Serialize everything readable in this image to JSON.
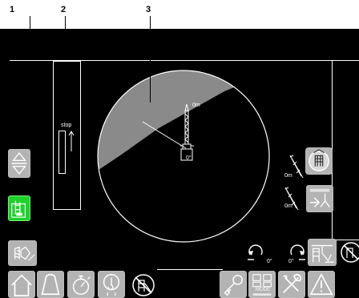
{
  "callouts": [
    "1",
    "2",
    "3"
  ],
  "boom_indicator": {
    "stop_label": "stop"
  },
  "dial": {
    "height_label": "0m",
    "angle_label": "0°",
    "colors": {
      "shade": "#8a8a8a",
      "ring": "#ffffff"
    }
  },
  "right_panel": {
    "upper_ramp_label": "0m",
    "lower_ramp_label": "0m"
  },
  "rotation": {
    "left_label": "0°",
    "right_label": "0°"
  },
  "bottom_bar": {
    "mode_label": "MODE"
  },
  "icons": {
    "left_column": [
      "up-down-arrows-icon",
      "tower-green-icon",
      "tower-indicator-icon"
    ],
    "bottom_left": [
      "home-icon",
      "weight-icon",
      "stopwatch-icon",
      "hook-speed-icon",
      "crane-off-icon"
    ],
    "bottom_right": [
      "key-icon",
      "mode-icon",
      "tools-icon",
      "warning-icon"
    ],
    "right_column": [
      "tower-base-icon",
      "trolley-retract-icon",
      "rotate-left-icon",
      "rotate-right-icon",
      "tower-crane-icon",
      "tower-crane-off-icon"
    ]
  },
  "colors": {
    "accent_green": "#1fd12a",
    "button_gray": "#b3b3b3",
    "screen_bg": "#000000"
  }
}
